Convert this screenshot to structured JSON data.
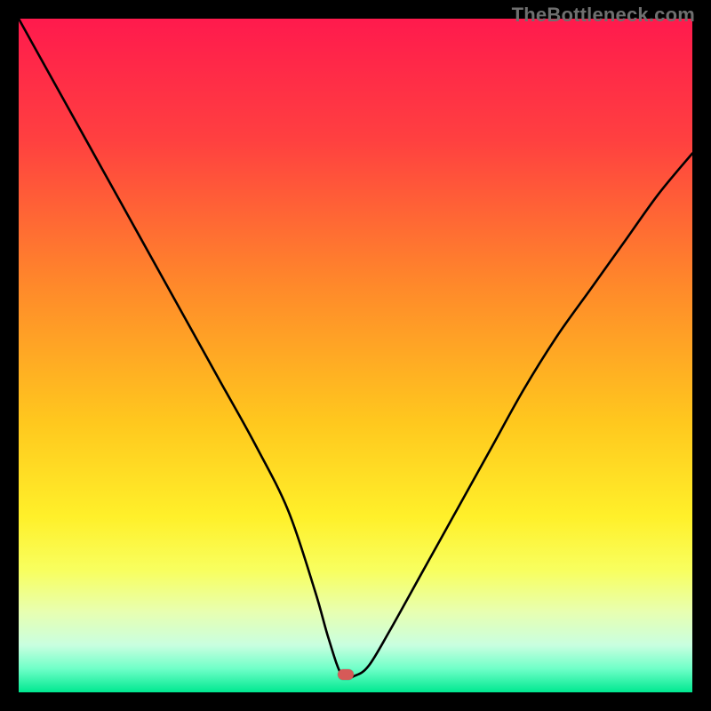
{
  "watermark": "TheBottleneck.com",
  "colors": {
    "frame": "#000000",
    "gradient_stops": [
      {
        "offset": 0.0,
        "color": "#ff1a4d"
      },
      {
        "offset": 0.18,
        "color": "#ff4040"
      },
      {
        "offset": 0.4,
        "color": "#ff8a2a"
      },
      {
        "offset": 0.6,
        "color": "#ffc81e"
      },
      {
        "offset": 0.74,
        "color": "#fff02a"
      },
      {
        "offset": 0.82,
        "color": "#f8ff60"
      },
      {
        "offset": 0.88,
        "color": "#e8ffb0"
      },
      {
        "offset": 0.93,
        "color": "#c9ffe0"
      },
      {
        "offset": 0.965,
        "color": "#6fffc8"
      },
      {
        "offset": 1.0,
        "color": "#00e890"
      }
    ],
    "curve": "#000000",
    "marker": "#d65a58"
  },
  "marker": {
    "x_pct": 48.5,
    "y_pct": 97.3
  },
  "chart_data": {
    "type": "line",
    "title": "",
    "xlabel": "",
    "ylabel": "",
    "xlim": [
      0,
      100
    ],
    "ylim": [
      0,
      100
    ],
    "grid": false,
    "legend": false,
    "series": [
      {
        "name": "bottleneck-curve",
        "x": [
          0,
          5,
          10,
          15,
          20,
          25,
          30,
          35,
          40,
          44,
          46,
          48,
          50,
          52,
          55,
          60,
          65,
          70,
          75,
          80,
          85,
          90,
          95,
          100
        ],
        "y": [
          100,
          91,
          82,
          73,
          64,
          55,
          46,
          37,
          27,
          15,
          8,
          2.5,
          2.5,
          4,
          9,
          18,
          27,
          36,
          45,
          53,
          60,
          67,
          74,
          80
        ]
      }
    ],
    "annotations": [
      {
        "type": "marker",
        "name": "bottleneck-point",
        "x": 48.5,
        "y": 2.7,
        "color": "#d65a58"
      }
    ],
    "background": {
      "type": "vertical-gradient",
      "meaning": "red=high bottleneck, green=low bottleneck",
      "stops": [
        {
          "pct": 0,
          "color": "#ff1a4d"
        },
        {
          "pct": 60,
          "color": "#ffc81e"
        },
        {
          "pct": 82,
          "color": "#f8ff60"
        },
        {
          "pct": 100,
          "color": "#00e890"
        }
      ]
    }
  }
}
